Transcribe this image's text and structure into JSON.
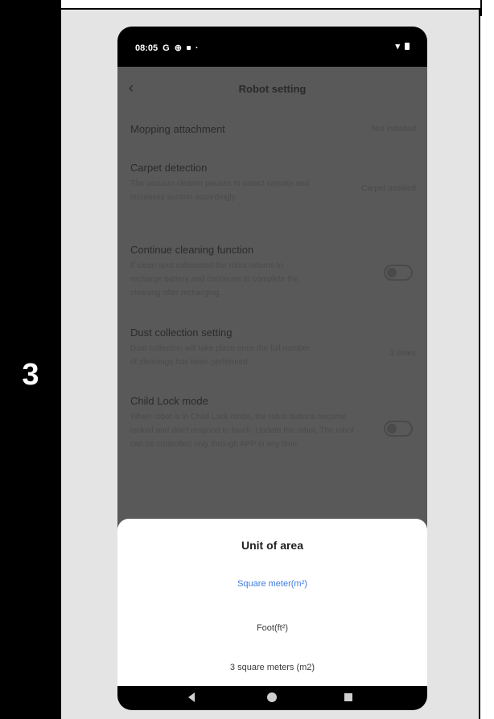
{
  "step": {
    "number": "3"
  },
  "status_bar": {
    "time": "08:05",
    "g_label": "G"
  },
  "header": {
    "title": "Robot setting"
  },
  "settings": [
    {
      "title": "Mopping attachment",
      "value": "Not installed"
    },
    {
      "title": "Carpet detection",
      "description": "The vacuum cleaner pauses to detect carpets and increases suction accordingly.",
      "value": "Carpet avoided"
    },
    {
      "title": "Continue cleaning function",
      "description": "If clean spot exhausted the robot returns to recharge battery and continues to complete the cleaning after recharging.",
      "toggle": "off"
    },
    {
      "title": "Dust collection setting",
      "description": "Dust collection will take place once the full number of cleanings has been performed.",
      "value": "3 times"
    },
    {
      "title": "Child Lock mode",
      "description": "When robot is in Child Lock mode, the robot buttons become locked and don't respond to touch. Update the robot. The robot can be controlled only through APP in any time.",
      "toggle": "off"
    }
  ],
  "sheet": {
    "title": "Unit of area",
    "options": [
      "Square meter(m²)",
      "Foot(ft²)",
      "3 square meters (m2)"
    ],
    "selected": "Square meter(m²)"
  },
  "colors": {
    "selected_option": "#3d7be0",
    "overlay": "#595959"
  }
}
